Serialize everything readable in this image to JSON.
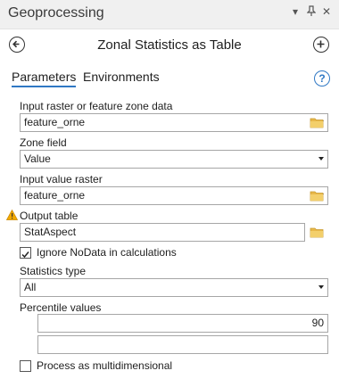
{
  "pane": {
    "title": "Geoprocessing",
    "controls": [
      "▾",
      "⊐",
      "✕"
    ]
  },
  "tool": {
    "title": "Zonal Statistics as Table"
  },
  "tabs": [
    "Parameters",
    "Environments"
  ],
  "help_glyph": "?",
  "params": {
    "zone_data": {
      "label": "Input raster or feature zone data",
      "value": "feature_orne"
    },
    "zone_field": {
      "label": "Zone field",
      "value": "Value"
    },
    "value_raster": {
      "label": "Input value raster",
      "value": "feature_orne"
    },
    "output_table": {
      "label": "Output table",
      "value": "StatAspect"
    },
    "ignore_nodata": {
      "label": "Ignore NoData in calculations",
      "checked": true
    },
    "statistics_type": {
      "label": "Statistics type",
      "value": "All"
    },
    "percentile": {
      "label": "Percentile values",
      "values": [
        "90",
        ""
      ]
    },
    "multidimensional": {
      "label": "Process as multidimensional",
      "checked": false
    }
  },
  "colors": {
    "accent": "#2f78c4",
    "folder": "#e8b84a",
    "warning": "#f2a900"
  }
}
